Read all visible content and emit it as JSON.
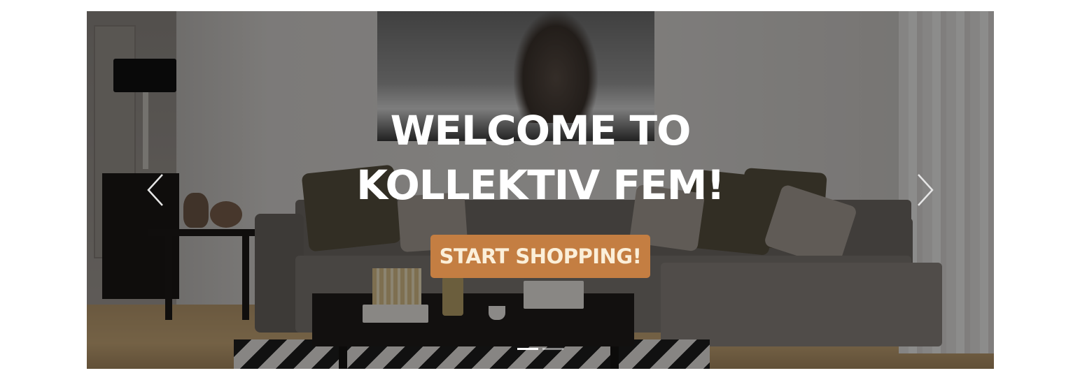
{
  "hero": {
    "headline_line1": "WELCOME TO",
    "headline_line2": "KOLLEKTIV FEM!",
    "cta_label": "START SHOPPING!",
    "background_image": "living-room-sofa-photo"
  },
  "carousel": {
    "prev_icon": "chevron-left-icon",
    "next_icon": "chevron-right-icon",
    "slide_count": 2,
    "active_slide": 1
  },
  "colors": {
    "cta_background": "#c47e42",
    "cta_text": "#fbefd9",
    "headline_text": "#ffffff",
    "page_background": "#ffffff"
  }
}
